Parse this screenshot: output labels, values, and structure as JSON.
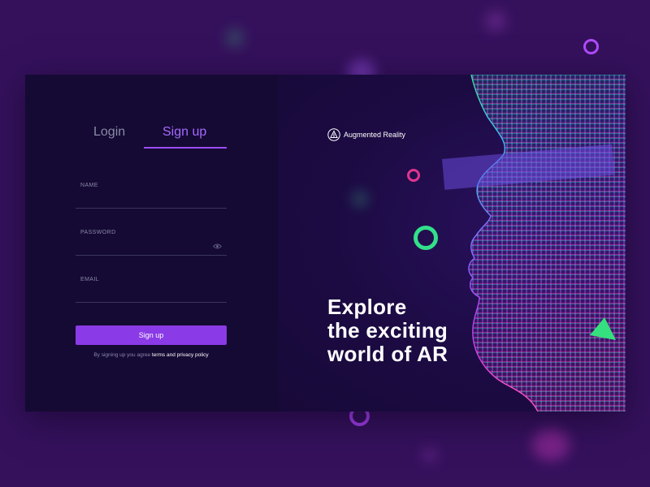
{
  "auth": {
    "tabs": [
      {
        "label": "Login",
        "active": false
      },
      {
        "label": "Sign up",
        "active": true
      }
    ],
    "fields": {
      "name": {
        "label": "NAME",
        "value": ""
      },
      "password": {
        "label": "PASSWORD",
        "value": ""
      },
      "email": {
        "label": "EMAIL",
        "value": ""
      }
    },
    "submit_label": "Sign up",
    "terms_prefix": "By signing up you agree ",
    "terms_link": "terms and privacy policy"
  },
  "hero": {
    "brand_name": "Augmented Reality",
    "brand_icon": "triangle-logo-icon",
    "headline_lines": [
      "Explore",
      "the exciting",
      "world of AR"
    ]
  },
  "colors": {
    "background": "#35115c",
    "card_left": "#150a33",
    "card_right": "#1c0b43",
    "accent": "#9b4dff",
    "button": "#8a3ae6",
    "neon_green": "#34e08a",
    "neon_pink": "#e03ad6"
  }
}
